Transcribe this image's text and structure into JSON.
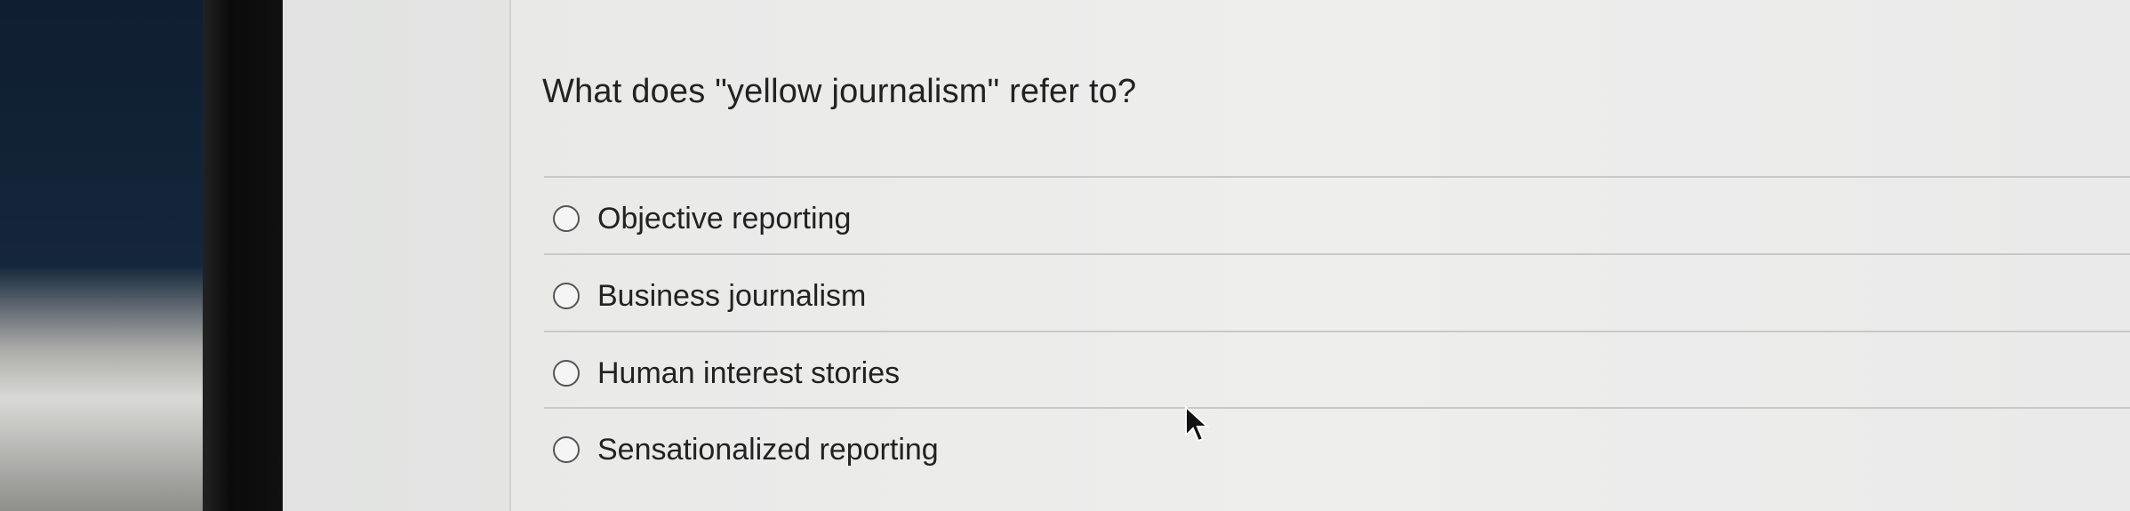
{
  "quiz": {
    "question": "What does \"yellow journalism\" refer to?",
    "options": [
      {
        "label": "Objective reporting",
        "selected": false
      },
      {
        "label": "Business journalism",
        "selected": false
      },
      {
        "label": "Human interest stories",
        "selected": false
      },
      {
        "label": "Sensationalized reporting",
        "selected": false
      }
    ]
  },
  "colors": {
    "text": "#222222",
    "background": "#ececeb",
    "divider": "#c9c9c8"
  }
}
